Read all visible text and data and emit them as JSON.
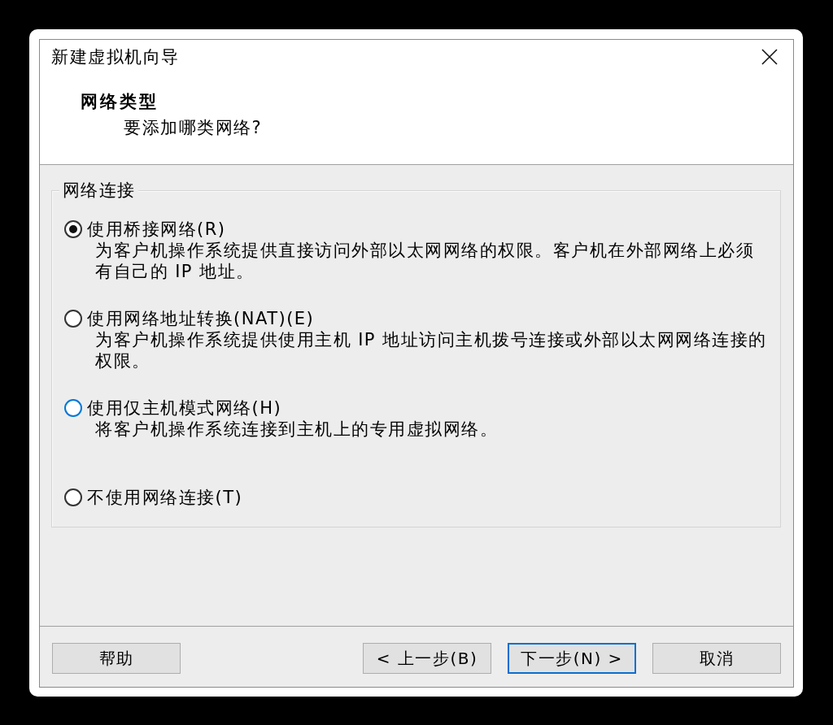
{
  "window": {
    "title": "新建虚拟机向导"
  },
  "header": {
    "title": "网络类型",
    "subtitle": "要添加哪类网络?"
  },
  "group": {
    "legend": "网络连接",
    "options": [
      {
        "label": "使用桥接网络(R)",
        "description": "为客户机操作系统提供直接访问外部以太网网络的权限。客户机在外部网络上必须有自己的 IP 地址。",
        "selected": true,
        "color": "#333333"
      },
      {
        "label": "使用网络地址转换(NAT)(E)",
        "description": "为客户机操作系统提供使用主机 IP 地址访问主机拨号连接或外部以太网网络连接的权限。",
        "selected": false,
        "color": "#333333"
      },
      {
        "label": "使用仅主机模式网络(H)",
        "description": "将客户机操作系统连接到主机上的专用虚拟网络。",
        "selected": false,
        "color": "#0078d7"
      },
      {
        "label": "不使用网络连接(T)",
        "selected": false,
        "color": "#333333"
      }
    ]
  },
  "footer": {
    "help": {
      "label": "帮助",
      "default": false
    },
    "buttons": [
      {
        "label": "< 上一步(B)",
        "default": false
      },
      {
        "label": "下一步(N) >",
        "default": true
      },
      {
        "label": "取消",
        "default": false
      }
    ]
  }
}
